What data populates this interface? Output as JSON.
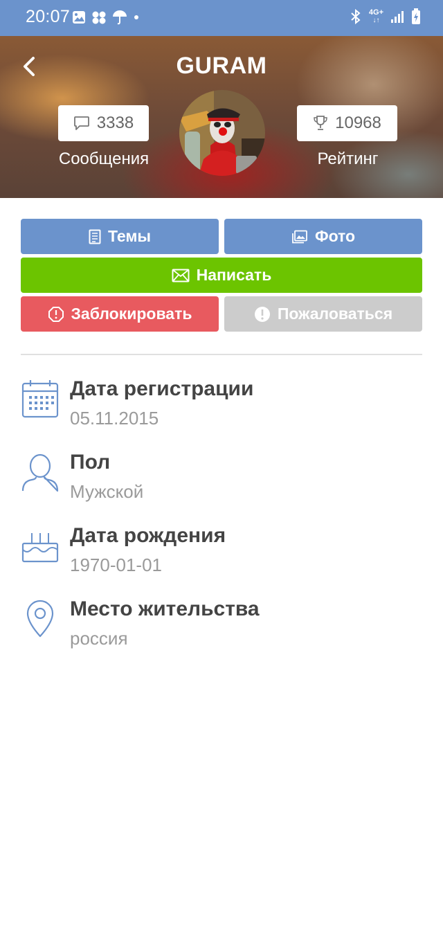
{
  "status_bar": {
    "time": "20:07",
    "network": "4G+"
  },
  "header": {
    "title": "GURAM",
    "messages_count": "3338",
    "messages_label": "Сообщения",
    "rating_count": "10968",
    "rating_label": "Рейтинг"
  },
  "buttons": {
    "topics": "Темы",
    "photo": "Фото",
    "write": "Написать",
    "block": "Заблокировать",
    "report": "Пожаловаться"
  },
  "info": [
    {
      "title": "Дата регистрации",
      "value": "05.11.2015",
      "icon": "calendar-icon"
    },
    {
      "title": "Пол",
      "value": "Мужской",
      "icon": "person-icon"
    },
    {
      "title": "Дата рождения",
      "value": "1970-01-01",
      "icon": "cake-icon"
    },
    {
      "title": "Место жительства",
      "value": "россия",
      "icon": "location-pin-icon"
    }
  ],
  "colors": {
    "primary": "#6b93cc",
    "write": "#6cc400",
    "block": "#e85a5f",
    "report": "#cccccc",
    "icon_blue": "#6b93cc"
  }
}
